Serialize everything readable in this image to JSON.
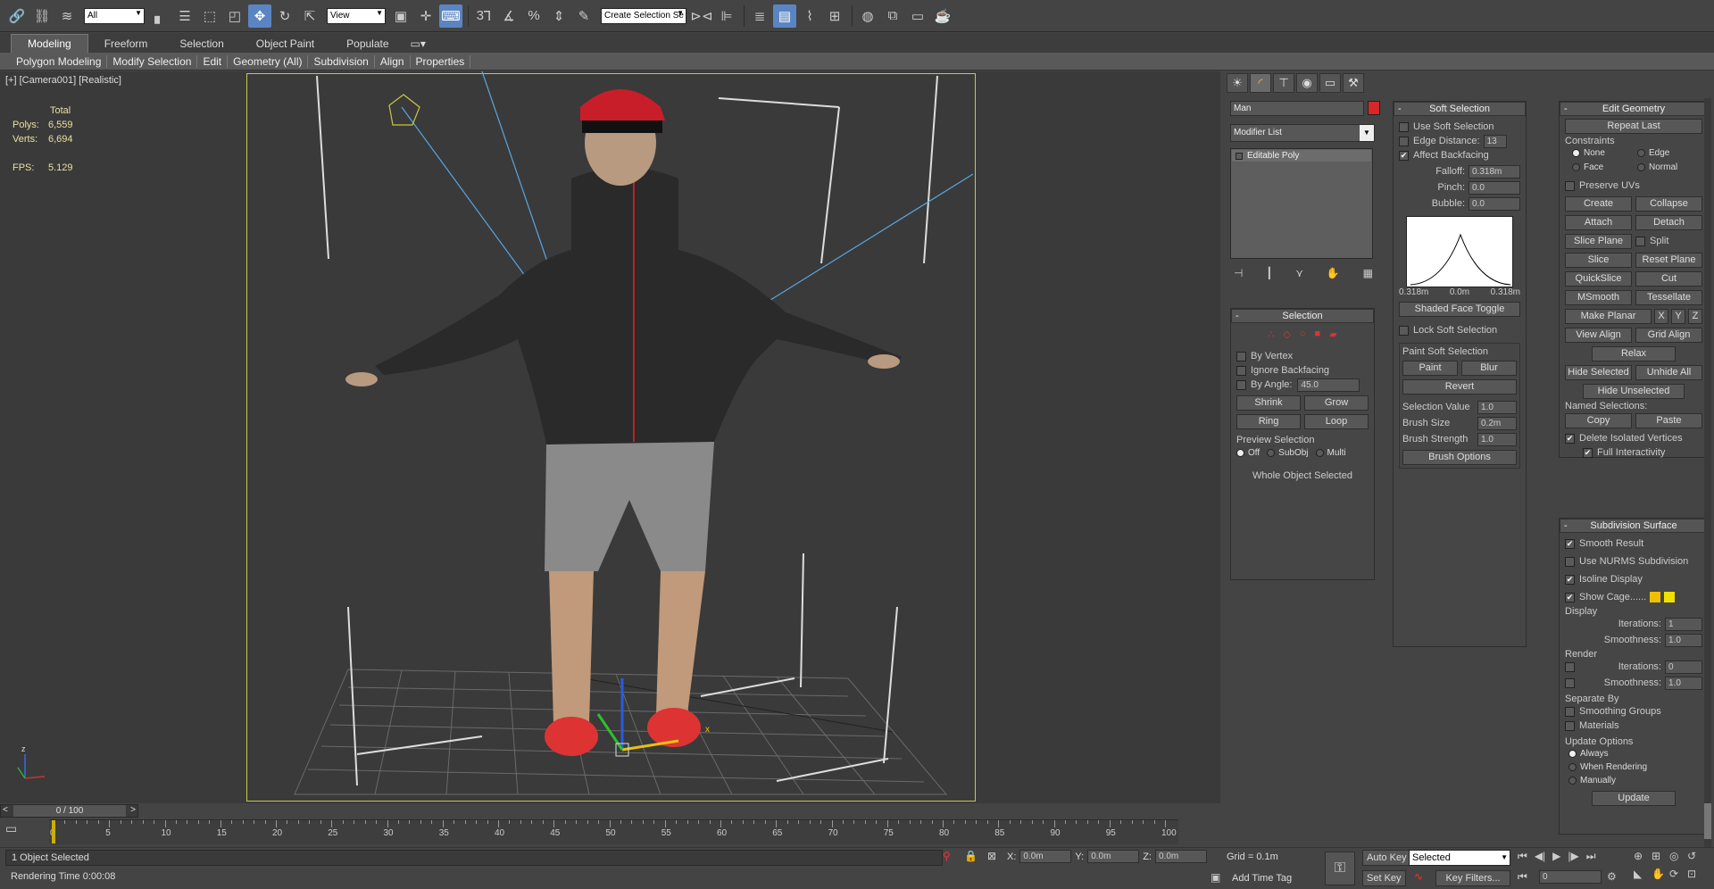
{
  "toolbar": {
    "filter_select": "All",
    "coord_select": "View",
    "named_selection_placeholder": "Create Selection Se",
    "snap_label": "3",
    "angle_label": "%"
  },
  "ribbon": {
    "tabs": [
      "Modeling",
      "Freeform",
      "Selection",
      "Object Paint",
      "Populate"
    ],
    "subtabs": [
      "Polygon Modeling",
      "Modify Selection",
      "Edit",
      "Geometry (All)",
      "Subdivision",
      "Align",
      "Properties"
    ]
  },
  "viewport": {
    "label": "[+] [Camera001] [Realistic]",
    "stats_header": "Total",
    "polys_label": "Polys:",
    "polys_value": "6,559",
    "verts_label": "Verts:",
    "verts_value": "6,694",
    "fps_label": "FPS:",
    "fps_value": "5.129",
    "axis_z": "z",
    "axis_x": "x"
  },
  "command_panel": {
    "object_name": "Man",
    "object_color": "#d62828",
    "modifier_list_label": "Modifier List",
    "modifier_stack": [
      "Editable Poly"
    ]
  },
  "selection_rollout": {
    "title": "Selection",
    "by_vertex": "By Vertex",
    "ignore_backfacing": "Ignore Backfacing",
    "by_angle": "By Angle:",
    "angle_value": "45.0",
    "shrink": "Shrink",
    "grow": "Grow",
    "ring": "Ring",
    "loop": "Loop",
    "preview_label": "Preview Selection",
    "preview_off": "Off",
    "preview_subobj": "SubObj",
    "preview_multi": "Multi",
    "status": "Whole Object Selected"
  },
  "soft_selection": {
    "title": "Soft Selection",
    "use_soft": "Use Soft Selection",
    "edge_distance": "Edge Distance:",
    "edge_distance_value": "13",
    "affect_backfacing": "Affect Backfacing",
    "falloff": "Falloff:",
    "falloff_value": "0.318m",
    "pinch": "Pinch:",
    "pinch_value": "0.0",
    "bubble": "Bubble:",
    "bubble_value": "0.0",
    "curve_left": "0.318m",
    "curve_mid": "0.0m",
    "curve_right": "0.318m",
    "shaded_face_toggle": "Shaded Face Toggle",
    "lock_soft": "Lock Soft Selection",
    "paint_group": "Paint Soft Selection",
    "paint": "Paint",
    "blur": "Blur",
    "revert": "Revert",
    "selection_value": "Selection Value",
    "selection_value_v": "1.0",
    "brush_size": "Brush Size",
    "brush_size_v": "0.2m",
    "brush_strength": "Brush Strength",
    "brush_strength_v": "1.0",
    "brush_options": "Brush Options"
  },
  "edit_geometry": {
    "title": "Edit Geometry",
    "repeat_last": "Repeat Last",
    "constraints": "Constraints",
    "none": "None",
    "edge": "Edge",
    "face": "Face",
    "normal": "Normal",
    "preserve_uvs": "Preserve UVs",
    "create": "Create",
    "collapse": "Collapse",
    "attach": "Attach",
    "detach": "Detach",
    "slice_plane": "Slice Plane",
    "split": "Split",
    "slice": "Slice",
    "reset_plane": "Reset Plane",
    "quickslice": "QuickSlice",
    "cut": "Cut",
    "msmooth": "MSmooth",
    "tessellate": "Tessellate",
    "make_planar": "Make Planar",
    "x": "X",
    "y": "Y",
    "z": "Z",
    "view_align": "View Align",
    "grid_align": "Grid Align",
    "relax": "Relax",
    "hide_selected": "Hide Selected",
    "unhide_all": "Unhide All",
    "hide_unselected": "Hide Unselected",
    "named_selections": "Named Selections:",
    "copy": "Copy",
    "paste": "Paste",
    "delete_isolated": "Delete Isolated Vertices",
    "full_interactivity": "Full Interactivity"
  },
  "subdivision_surface": {
    "title": "Subdivision Surface",
    "smooth_result": "Smooth Result",
    "use_nurms": "Use NURMS Subdivision",
    "isoline_display": "Isoline Display",
    "show_cage": "Show Cage......",
    "display": "Display",
    "iterations": "Iterations:",
    "display_iterations": "1",
    "smoothness": "Smoothness:",
    "display_smoothness": "1.0",
    "render": "Render",
    "render_iterations": "0",
    "render_smoothness": "1.0",
    "separate_by": "Separate By",
    "smoothing_groups": "Smoothing Groups",
    "materials": "Materials",
    "update_options": "Update Options",
    "always": "Always",
    "when_rendering": "When Rendering",
    "manually": "Manually",
    "update": "Update"
  },
  "timeline": {
    "frame_counter": "0 / 100",
    "ticks": [
      "0",
      "5",
      "10",
      "15",
      "20",
      "25",
      "30",
      "35",
      "40",
      "45",
      "50",
      "55",
      "60",
      "65",
      "70",
      "75",
      "80",
      "85",
      "90",
      "95",
      "100"
    ]
  },
  "status": {
    "selected": "1 Object Selected",
    "rendering_time": "Rendering Time  0:00:08",
    "x_label": "X:",
    "x_value": "0.0m",
    "y_label": "Y:",
    "y_value": "0.0m",
    "z_label": "Z:",
    "z_value": "0.0m",
    "grid": "Grid = 0.1m",
    "add_time_tag": "Add Time Tag",
    "auto_key": "Auto Key",
    "set_key": "Set Key",
    "key_mode": "Selected",
    "key_filters": "Key Filters...",
    "current_frame": "0"
  }
}
